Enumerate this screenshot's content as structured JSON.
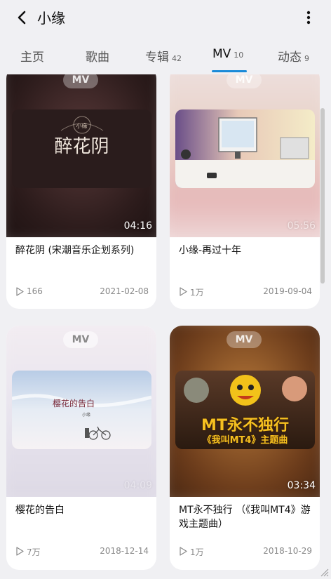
{
  "header": {
    "title": "小缘"
  },
  "tabs": [
    {
      "label": "主页",
      "count": ""
    },
    {
      "label": "歌曲",
      "count": ""
    },
    {
      "label": "专辑",
      "count": "42"
    },
    {
      "label": "MV",
      "count": "10"
    },
    {
      "label": "动态",
      "count": "9"
    }
  ],
  "active_tab": "MV",
  "videos": [
    {
      "badge": "MV",
      "thumb_text": "醉花阴",
      "thumb_subtext": "小缘",
      "duration": "04:16",
      "title": "醉花阴 (宋潮音乐企划系列)",
      "plays": "166",
      "date": "2021-02-08"
    },
    {
      "badge": "MV",
      "duration": "05:56",
      "title": "小缘-再过十年",
      "plays": "1万",
      "date": "2019-09-04"
    },
    {
      "badge": "MV",
      "thumb_text": "樱花的告白",
      "thumb_subtext": "小缘",
      "duration": "04:09",
      "title": "樱花的告白",
      "plays": "7万",
      "date": "2018-12-14"
    },
    {
      "badge": "MV",
      "thumb_text": "MT永不独行",
      "thumb_subtext": "《我叫MT4》主题曲",
      "duration": "03:34",
      "title": "MT永不独行 （《我叫MT4》游戏主题曲）",
      "plays": "1万",
      "date": "2018-10-29"
    }
  ],
  "colors": {
    "accent": "#1a8ad8",
    "background": "#f0f0f3",
    "card": "#ffffff",
    "meta_text": "#888888"
  },
  "icons": {
    "back": "back-arrow-icon",
    "more": "more-vertical-icon",
    "play": "play-icon",
    "resize": "resize-grip-icon"
  }
}
